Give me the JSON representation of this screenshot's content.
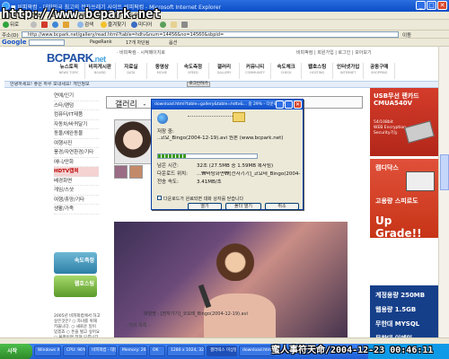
{
  "window": {
    "title": "■ 비피팍컴 - 대한민국 최고의 전자쓰레기 사이트 비피팍컴 - Microsoft Internet Explorer",
    "watermark": "http://www.bcpark.net"
  },
  "menu": [
    "파일(F)",
    "편집(E)",
    "보기(V)",
    "즐겨찾기(A)",
    "도구(T)",
    "도움말(H)"
  ],
  "toolbar": {
    "back": "뒤로",
    "buttons": [
      "검색",
      "즐겨찾기",
      "미디어"
    ]
  },
  "address": {
    "label": "주소(D)",
    "url": "http://www.bcpark.net/gallery/read.html?table=hdtv&num=14456&no=14560&sbpid=",
    "go": "이동"
  },
  "google": {
    "logo": "Google",
    "buttons": [
      "PageRank",
      "17개 차단됨",
      "옵션"
    ]
  },
  "site": {
    "logo": "BCPARK",
    "logo_suffix": ".net",
    "top_links": "· 비피팍컴 · 시작페이지로",
    "top_right": "비피팍컴 | 회원가입 | 로그인 | 모아보기",
    "nav": [
      {
        "label": "뉴스토픽",
        "sub": "NEWS TOPIC"
      },
      {
        "label": "비피게시판",
        "sub": "BOARD"
      },
      {
        "label": "자료실",
        "sub": "DATA"
      },
      {
        "label": "동영상",
        "sub": "MOVIE"
      },
      {
        "label": "속도측정",
        "sub": "SPEED"
      },
      {
        "label": "갤러리",
        "sub": "GALLERY"
      },
      {
        "label": "커뮤니티",
        "sub": "COMMUNITY"
      },
      {
        "label": "속도체크",
        "sub": "CHECK"
      },
      {
        "label": "웹호스팅",
        "sub": "HOSTING"
      },
      {
        "label": "인터넷가입",
        "sub": "INTERNET"
      },
      {
        "label": "공동구매",
        "sub": "SHOPPING"
      }
    ],
    "info": "안녕하세요! 좋은 하루 보내세요! 개인정보",
    "login": "로그인하기",
    "side_menu": [
      "연예/인기",
      "스타/팬덤",
      "컴퓨터/IT제품",
      "자동차/바퀴달기",
      "동물/애완동물",
      "여행사진",
      "풍경/자연환경/기타",
      "애니/만화",
      "HDTV캡쳐",
      "배경화면",
      "게임/스샷",
      "여행/휴양/기타",
      "생활/가족"
    ],
    "side_active_index": 8,
    "side_btn1": "속도측정",
    "side_btn2": "웹호스팅",
    "poll": "2005년 비피팍컴에서 하고 싶은것은? ○ 자녀를 위해 키웁니다. ○ 새로운 일이 있겠죠 ○ 돈을 벌고 싶어요 ○ 불평이면 전혀 모릅니다.",
    "gallery_title": "갤러리 - HDTV캡쳐",
    "filename": "파일명 : [전자기기]_코요테_Bingo(2004-12-19).avi",
    "mirror": "- 미러 목록 -",
    "photo_caption": ""
  },
  "ads": {
    "ad1": {
      "head": "USB무선 랜카드",
      "model": "CMUA540V",
      "desc": "54/108bit\nWEB Encryption\nSecurity기능"
    },
    "ad2": {
      "head": "캠디닥스",
      "slogan": "고용량 스피로도",
      "upgrade": "Up Grade!!"
    },
    "ad3": {
      "lines": [
        "계정용량 250MB",
        "웹용량 1.5GB",
        "무한대 MYSQL",
        "무한대 이메일",
        "1년 22,000원"
      ]
    }
  },
  "dialog": {
    "title": "download.html?table=gallery&table=hdtv&... 중 29% - 다운로드 완료",
    "source_label": "저장 중:",
    "source": "..코요_Bingo(2004-12-19).avi 원본 (www.bcpark.net)",
    "remaining_label": "남은 시간:",
    "remaining": "32초 (27.5MB 중 1.59MB 복사됨)",
    "dest_label": "다운로드 위치:",
    "dest": "...₩바탕화면₩[전자기기]_코요테_Bingo(2004-12-19).avi",
    "rate_label": "전송 속도:",
    "rate": "3.41MB/초",
    "autoclose": "다운로드가 완료되면 대화 상자를 닫습니다",
    "progress": 0.29,
    "btn_open": "열기",
    "btn_folder": "폴더 열기",
    "btn_cancel": "취소"
  },
  "taskbar": {
    "start": "시작",
    "tasks": [
      "Windows XP",
      "CPU: 96%",
      "비피팍컴 - 대한...",
      "Memory: 26986",
      "OK",
      "1280 x 1024, 32 bit",
      "갤러릭스 미상할...",
      "download.html..."
    ],
    "active_index": 6,
    "timestamp": "蜜人事符天命/2004-12-23 00:46:11"
  }
}
